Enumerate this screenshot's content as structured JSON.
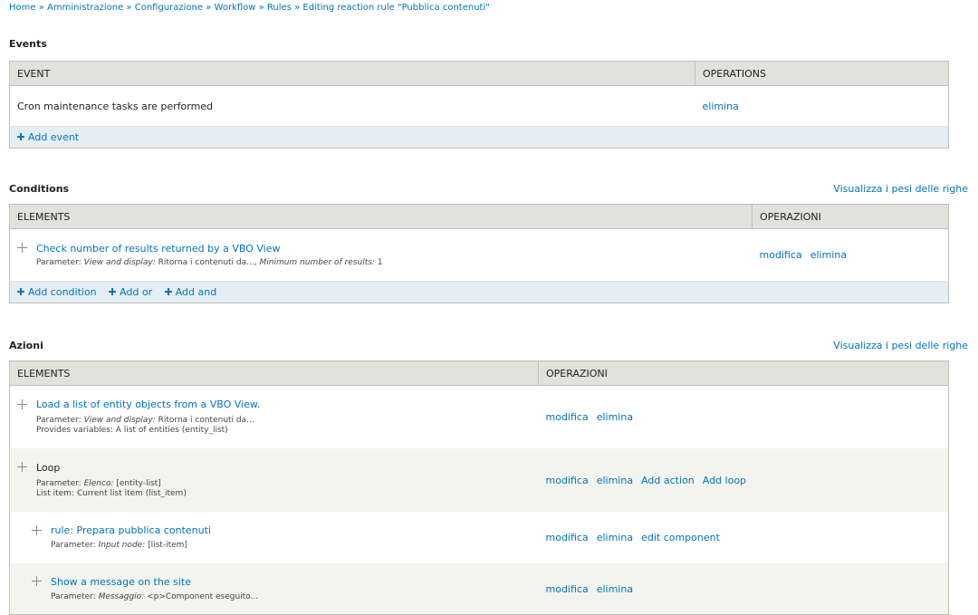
{
  "breadcrumb": [
    "Home",
    "Amministrazione",
    "Configurazione",
    "Workflow",
    "Rules",
    "Editing reaction rule \"Pubblica contenuti\""
  ],
  "events": {
    "title": "Events",
    "col_event": "EVENT",
    "col_operations": "OPERATIONS",
    "rows": [
      {
        "label": "Cron maintenance tasks are performed",
        "op": "elimina"
      }
    ],
    "add_event": "Add event"
  },
  "conditions": {
    "title": "Conditions",
    "weights_link": "Visualizza i pesi delle righe",
    "col_elements": "ELEMENTS",
    "col_ops": "OPERAZIONI",
    "rows": [
      {
        "title": "Check number of results returned by a VBO View",
        "param_prefix": "Parameter: ",
        "p1_label": "View and display:",
        "p1_value": " Ritorna i contenuti da..., ",
        "p2_label": "Minimum number of results:",
        "p2_value": " 1",
        "op_edit": "modifica",
        "op_delete": "elimina"
      }
    ],
    "add_condition": "Add condition",
    "add_or": "Add or",
    "add_and": "Add and"
  },
  "actions": {
    "title": "Azioni",
    "weights_link": "Visualizza i pesi delle righe",
    "col_elements": "ELEMENTS",
    "col_ops": "OPERAZIONI",
    "rows": [
      {
        "title": "Load a list of entity objects from a VBO View.",
        "param_prefix": "Parameter: ",
        "p1_label": "View and display:",
        "p1_value": " Ritorna i contenuti da...",
        "extra": "Provides variables: A list of entities (entity_list)",
        "ops": [
          "modifica",
          "elimina"
        ]
      },
      {
        "title": "Loop",
        "param_prefix": "Parameter: ",
        "p1_label": "Elenco:",
        "p1_value": " [entity-list]",
        "extra": "List item: Current list item (list_item)",
        "ops": [
          "modifica",
          "elimina",
          "Add action",
          "Add loop"
        ]
      },
      {
        "title": "rule: Prepara pubblica contenuti",
        "param_prefix": "Parameter: ",
        "p1_label": "Input node:",
        "p1_value": " [list-item]",
        "ops": [
          "modifica",
          "elimina",
          "edit component"
        ]
      },
      {
        "title": "Show a message on the site",
        "param_prefix": "Parameter: ",
        "p1_label": "Messaggio:",
        "p1_value": " <p>Component eseguito...",
        "ops": [
          "modifica",
          "elimina"
        ]
      }
    ]
  }
}
